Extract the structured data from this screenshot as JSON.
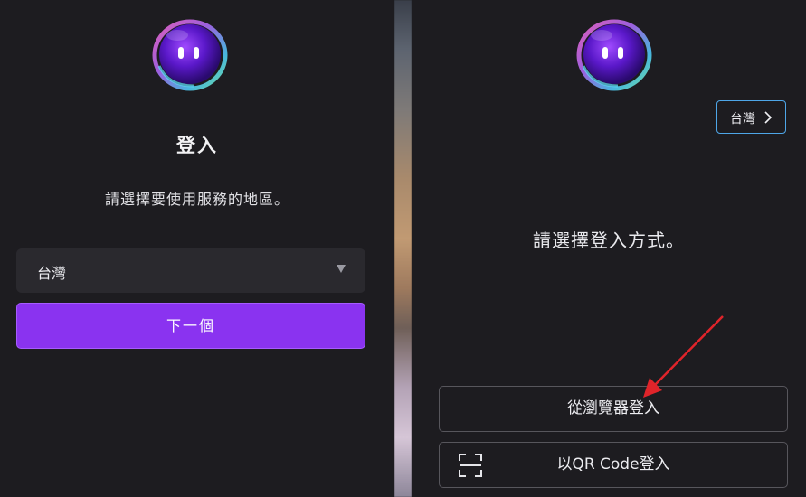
{
  "left_panel": {
    "logo_icon": "mascot-logo-icon",
    "title": "登入",
    "subtitle": "請選擇要使用服務的地區。",
    "region_select": {
      "selected": "台灣",
      "arrow_icon": "dropdown-triangle-icon"
    },
    "next_button_label": "下一個"
  },
  "right_panel": {
    "logo_icon": "mascot-logo-icon",
    "region_chip": {
      "label": "台灣",
      "icon": "chevron-right-icon"
    },
    "prompt": "請選擇登入方式。",
    "browser_login_label": "從瀏覽器登入",
    "qr_login_label": "以QR Code登入",
    "qr_icon": "qr-scan-icon"
  },
  "annotation": {
    "arrow_color": "#e0242a",
    "arrow_icon": "red-pointer-arrow"
  },
  "colors": {
    "panel_bg": "#1d1c20",
    "accent_purple": "#8a33f0",
    "chip_border": "#4ea6e8",
    "button_border": "#57565c"
  }
}
